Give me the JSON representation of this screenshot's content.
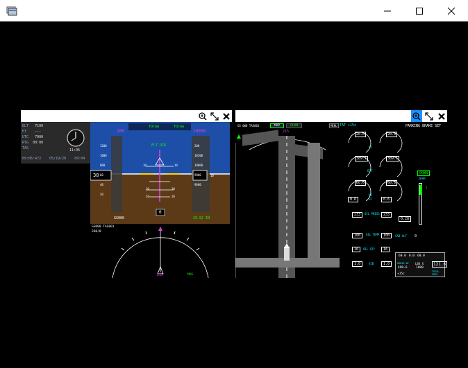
{
  "window": {
    "icon": "app-icon",
    "controls": [
      "minimize",
      "maximize",
      "close"
    ]
  },
  "left_panel": {
    "toolbar_icons": [
      "zoom-in-icon",
      "expand-icon",
      "close-icon"
    ],
    "clock_panel": {
      "rows": [
        {
          "label": "ELT",
          "value": "7100"
        },
        {
          "label": "ET",
          "value": "---"
        },
        {
          "label": "UTC",
          "value": "7000"
        },
        {
          "label": "RTG",
          "value": "00:00"
        },
        {
          "label": "TAS",
          "value": ""
        }
      ],
      "footer": [
        "09:06:472",
        "05/19/20",
        "09:04"
      ],
      "clock_time": "11:06"
    },
    "pfd": {
      "top_modes": [
        "TO/GA",
        "TO/GA"
      ],
      "speed": "200",
      "altitude": "10000",
      "flight_director": "FLT DIR",
      "left_scale": [
        "1200",
        "1000",
        "800",
        "60",
        "40",
        "20"
      ],
      "right_scale": [
        "200",
        "10200",
        "10000",
        "9800",
        "9600"
      ],
      "pitch_labels": [
        "10",
        "10",
        "10",
        "10",
        "20",
        "20"
      ],
      "speed_box": "38",
      "bottom_left": "GS000",
      "bottom_center": "0",
      "bottom_right": "29.92 IN",
      "right_small": "10"
    },
    "nd": {
      "heading_readout": "GS000 TAS001",
      "wind": "260/0",
      "bottom_value": "215",
      "bottom_label": "MAG"
    }
  },
  "right_panel": {
    "toolbar_icons": [
      "zoom-in-icon",
      "expand-icon",
      "close-icon"
    ],
    "header_left": "GS 000 TAS001",
    "mode_buttons": [
      "MAP",
      "PLAN"
    ],
    "menu_label": "MENU",
    "tat": "TAT +15c",
    "parking_brake": "PARKING BRAKE SET",
    "heading": "215",
    "engine_gauges": [
      {
        "value": "20.0",
        "label": "N1"
      },
      {
        "value": "20.0",
        "label": "N1"
      },
      {
        "value": "389.1",
        "label": "EGT"
      },
      {
        "value": "389.1",
        "label": "EGT"
      },
      {
        "value": "60.0",
        "label": "N2"
      },
      {
        "value": "60.0",
        "label": "N2"
      }
    ],
    "ff_values": [
      "0.6",
      "0.6"
    ],
    "ff_label": "FF",
    "oil_values": [
      "233",
      "233"
    ],
    "oil_label": "OIL PRESS",
    "temp_values": [
      "100",
      "100"
    ],
    "temp_label": "OIL TEMP",
    "qty_values": [
      "16",
      "16"
    ],
    "qty_label": "OIL QTY",
    "vib_values": [
      "1.0",
      "1.0"
    ],
    "vib_label": "VIB",
    "fuel_flow": "0.28",
    "cab_alt_label": "CAB ALT",
    "cab_alt_value": "0",
    "gear_label": "GEAR",
    "gear_status": "DOWN",
    "flap_value": "1",
    "fuel_panel": {
      "tanks": [
        "60.0",
        "0.0",
        "60.0"
      ],
      "left_label": "GROSS WT",
      "left_value": "490.6",
      "center_label": "LBS X",
      "center_value": "1000",
      "right_label": "TOTAL FUEL",
      "right_value": "121.6",
      "bottom_left": "+15c"
    }
  }
}
